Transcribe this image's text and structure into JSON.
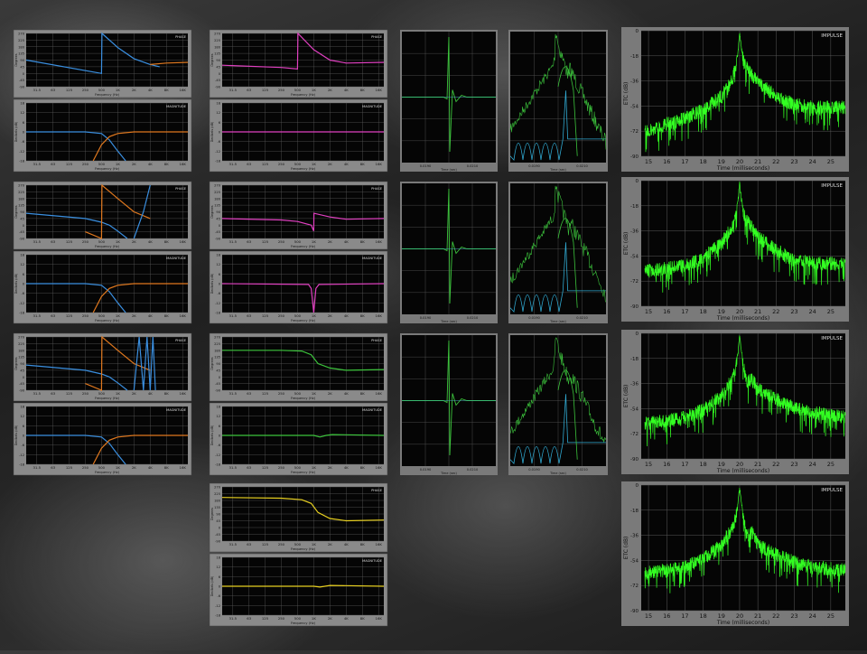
{
  "freq_ticks": [
    "31.5",
    "63",
    "125",
    "250",
    "500",
    "1K",
    "2K",
    "4K",
    "8K",
    "16K"
  ],
  "phase_ticks": [
    "270",
    "225",
    "180",
    "135",
    "90",
    "45",
    "0",
    "-45",
    "-90"
  ],
  "mag_ticks": [
    "18",
    "12",
    "6",
    "0",
    "-6",
    "-12",
    "-18"
  ],
  "labels": {
    "phase": "PHASE",
    "magnitude": "MAGNITUDE",
    "impulse": "IMPULSE",
    "freq_axis": "Frequency (Hz)",
    "phase_axis": "Degrees",
    "mag_axis": "Decibels (dB)",
    "time_axis": "Time (sec)",
    "etc_time_axis": "Time (milliseconds)",
    "etc_axis": "ETC (dB)"
  },
  "colors": {
    "blue": "#3a8fe0",
    "orange": "#e0781e",
    "magenta": "#e040c0",
    "green": "#3cc43c",
    "yellow": "#e8d020",
    "lime": "#33ff22",
    "cyan": "#30a8d0",
    "plot_bg": "#050505",
    "grid": "#5a5a5a"
  },
  "impulse_time_ticks": [
    "0.0190",
    "0.0210"
  ],
  "chart_data": [
    {
      "type": "line",
      "id": "phase-1",
      "title": "PHASE",
      "xlabel": "Frequency (Hz)",
      "ylabel": "Degrees",
      "ylim": [
        -90,
        270
      ],
      "xscale": "log",
      "series": [
        {
          "color": "blue",
          "x": [
            20,
            500,
            510,
            1000,
            2000,
            4000,
            6000
          ],
          "y": [
            90,
            0,
            270,
            175,
            100,
            60,
            45
          ]
        },
        {
          "color": "orange",
          "x": [
            4000,
            8000,
            20000
          ],
          "y": [
            60,
            70,
            75
          ]
        }
      ]
    },
    {
      "type": "line",
      "id": "mag-1",
      "title": "MAGNITUDE",
      "xlabel": "Frequency (Hz)",
      "ylabel": "Decibels (dB)",
      "ylim": [
        -18,
        18
      ],
      "xscale": "log",
      "series": [
        {
          "color": "blue",
          "x": [
            20,
            250,
            500,
            700,
            1000,
            1400
          ],
          "y": [
            0,
            0,
            -1,
            -5,
            -12,
            -18
          ]
        },
        {
          "color": "orange",
          "x": [
            350,
            500,
            700,
            1000,
            2000,
            20000
          ],
          "y": [
            -18,
            -8,
            -3,
            -1,
            0,
            0
          ]
        }
      ]
    },
    {
      "type": "line",
      "id": "phase-2",
      "title": "PHASE",
      "xlabel": "Frequency (Hz)",
      "ylabel": "Degrees",
      "ylim": [
        -90,
        270
      ],
      "xscale": "log",
      "series": [
        {
          "color": "magenta",
          "x": [
            20,
            250,
            500,
            510,
            1000,
            2000,
            4000,
            20000
          ],
          "y": [
            55,
            40,
            30,
            270,
            160,
            90,
            70,
            75
          ]
        }
      ]
    },
    {
      "type": "line",
      "id": "mag-2",
      "title": "MAGNITUDE",
      "xlabel": "Frequency (Hz)",
      "ylabel": "Decibels (dB)",
      "ylim": [
        -18,
        18
      ],
      "xscale": "log",
      "series": [
        {
          "color": "magenta",
          "x": [
            20,
            20000
          ],
          "y": [
            0,
            0
          ]
        }
      ]
    },
    {
      "type": "line",
      "id": "phase-3",
      "title": "PHASE",
      "xlabel": "Frequency (Hz)",
      "ylabel": "Degrees",
      "ylim": [
        -90,
        270
      ],
      "xscale": "log",
      "series": [
        {
          "color": "blue",
          "x": [
            20,
            250,
            500,
            700,
            1000,
            1500
          ],
          "y": [
            80,
            45,
            20,
            0,
            -40,
            -90
          ]
        },
        {
          "color": "orange",
          "x": [
            250,
            500,
            510,
            1000,
            2000,
            4000
          ],
          "y": [
            -45,
            -90,
            270,
            180,
            90,
            45
          ]
        },
        {
          "color": "blue",
          "x": [
            2000,
            3000,
            4000
          ],
          "y": [
            -90,
            90,
            270
          ]
        }
      ]
    },
    {
      "type": "line",
      "id": "mag-3",
      "title": "MAGNITUDE",
      "xlabel": "Frequency (Hz)",
      "ylabel": "Decibels (dB)",
      "ylim": [
        -18,
        18
      ],
      "xscale": "log",
      "series": [
        {
          "color": "blue",
          "x": [
            20,
            250,
            500,
            700,
            1000,
            1400
          ],
          "y": [
            0,
            0,
            -1,
            -5,
            -12,
            -18
          ]
        },
        {
          "color": "orange",
          "x": [
            350,
            500,
            700,
            1000,
            2000,
            20000
          ],
          "y": [
            -18,
            -8,
            -3,
            -1,
            0,
            0
          ]
        }
      ]
    },
    {
      "type": "line",
      "id": "phase-4",
      "title": "PHASE",
      "xlabel": "Frequency (Hz)",
      "ylabel": "Degrees",
      "ylim": [
        -90,
        270
      ],
      "xscale": "log",
      "series": [
        {
          "color": "magenta",
          "x": [
            20,
            250,
            500,
            900,
            1000,
            1010,
            2000,
            4000,
            20000
          ],
          "y": [
            45,
            35,
            25,
            0,
            -40,
            80,
            55,
            40,
            45
          ]
        }
      ]
    },
    {
      "type": "line",
      "id": "mag-4",
      "title": "MAGNITUDE",
      "xlabel": "Frequency (Hz)",
      "ylabel": "Decibels (dB)",
      "ylim": [
        -18,
        18
      ],
      "xscale": "log",
      "series": [
        {
          "color": "magenta",
          "x": [
            20,
            800,
            900,
            1000,
            1100,
            1250,
            20000
          ],
          "y": [
            0,
            -0.5,
            -3,
            -18,
            -3,
            -0.5,
            0
          ]
        }
      ]
    },
    {
      "type": "line",
      "id": "phase-5",
      "title": "PHASE",
      "xlabel": "Frequency (Hz)",
      "ylabel": "Degrees",
      "ylim": [
        -90,
        270
      ],
      "xscale": "log",
      "series": [
        {
          "color": "blue",
          "x": [
            20,
            250,
            500,
            700,
            1000,
            1500
          ],
          "y": [
            80,
            45,
            20,
            0,
            -40,
            -90
          ]
        },
        {
          "color": "orange",
          "x": [
            250,
            500,
            510,
            1000,
            2000,
            4000
          ],
          "y": [
            -45,
            -90,
            270,
            180,
            90,
            45
          ]
        },
        {
          "color": "blue",
          "x": [
            2000,
            2500,
            3000,
            3500,
            4000,
            4500,
            5000
          ],
          "y": [
            -90,
            270,
            -90,
            270,
            -90,
            270,
            -90
          ]
        }
      ]
    },
    {
      "type": "line",
      "id": "mag-5",
      "title": "MAGNITUDE",
      "xlabel": "Frequency (Hz)",
      "ylabel": "Decibels (dB)",
      "ylim": [
        -18,
        18
      ],
      "xscale": "log",
      "series": [
        {
          "color": "blue",
          "x": [
            20,
            250,
            500,
            700,
            1000,
            1400
          ],
          "y": [
            0,
            0,
            -1,
            -5,
            -12,
            -18
          ]
        },
        {
          "color": "orange",
          "x": [
            350,
            500,
            700,
            1000,
            2000,
            20000
          ],
          "y": [
            -18,
            -8,
            -3,
            -1,
            0,
            0
          ]
        }
      ]
    },
    {
      "type": "line",
      "id": "phase-6",
      "title": "PHASE",
      "xlabel": "Frequency (Hz)",
      "ylabel": "Degrees",
      "ylim": [
        -90,
        270
      ],
      "xscale": "log",
      "series": [
        {
          "color": "green",
          "x": [
            20,
            250,
            600,
            900,
            1200,
            2000,
            4000,
            20000
          ],
          "y": [
            180,
            180,
            175,
            150,
            90,
            60,
            45,
            50
          ]
        }
      ]
    },
    {
      "type": "line",
      "id": "mag-6",
      "title": "MAGNITUDE",
      "xlabel": "Frequency (Hz)",
      "ylabel": "Decibels (dB)",
      "ylim": [
        -18,
        18
      ],
      "xscale": "log",
      "series": [
        {
          "color": "green",
          "x": [
            20,
            1000,
            1300,
            1700,
            2200,
            20000
          ],
          "y": [
            0,
            0,
            -1,
            0,
            0.5,
            0
          ]
        }
      ]
    },
    {
      "type": "line",
      "id": "phase-7",
      "title": "PHASE",
      "xlabel": "Frequency (Hz)",
      "ylabel": "Degrees",
      "ylim": [
        -90,
        270
      ],
      "xscale": "log",
      "series": [
        {
          "color": "yellow",
          "x": [
            20,
            250,
            600,
            900,
            1200,
            2000,
            4000,
            20000
          ],
          "y": [
            200,
            195,
            185,
            160,
            100,
            60,
            45,
            50
          ]
        }
      ]
    },
    {
      "type": "line",
      "id": "mag-7",
      "title": "MAGNITUDE",
      "xlabel": "Frequency (Hz)",
      "ylabel": "Decibels (dB)",
      "ylim": [
        -18,
        18
      ],
      "xscale": "log",
      "series": [
        {
          "color": "yellow",
          "x": [
            20,
            1000,
            1300,
            2000,
            20000
          ],
          "y": [
            0,
            0,
            -0.5,
            0.5,
            0
          ]
        }
      ]
    },
    {
      "type": "line",
      "id": "etc-1",
      "title": "IMPULSE",
      "xlabel": "Time (milliseconds)",
      "ylabel": "ETC (dB)",
      "xlim": [
        14.6,
        25.8
      ],
      "ylim": [
        -90,
        0
      ],
      "x_ticks": [
        15,
        16,
        17,
        18,
        19,
        20,
        21,
        22,
        23,
        24,
        25
      ],
      "y_ticks": [
        0,
        -18,
        -36,
        -54,
        -72,
        -90
      ],
      "series": [
        {
          "color": "lime",
          "x": [
            14.8,
            16,
            17,
            18,
            19,
            19.6,
            19.9,
            20,
            20.1,
            20.3,
            21,
            22,
            23,
            24,
            25.8
          ],
          "y": [
            -68,
            -62,
            -58,
            -52,
            -42,
            -30,
            -15,
            0,
            -12,
            -20,
            -32,
            -42,
            -48,
            -50,
            -50
          ]
        }
      ]
    },
    {
      "type": "line",
      "id": "etc-2",
      "title": "IMPULSE",
      "xlabel": "Time (milliseconds)",
      "ylabel": "ETC (dB)",
      "xlim": [
        14.6,
        25.8
      ],
      "ylim": [
        -90,
        0
      ],
      "x_ticks": [
        15,
        16,
        17,
        18,
        19,
        20,
        21,
        22,
        23,
        24,
        25
      ],
      "y_ticks": [
        0,
        -18,
        -36,
        -54,
        -72,
        -90
      ],
      "series": [
        {
          "color": "lime",
          "x": [
            14.8,
            16,
            17,
            18,
            19,
            19.6,
            19.9,
            20,
            20.1,
            20.3,
            21,
            22,
            23,
            24,
            25.8
          ],
          "y": [
            -60,
            -58,
            -56,
            -50,
            -40,
            -28,
            -14,
            0,
            -12,
            -22,
            -35,
            -45,
            -52,
            -54,
            -55
          ]
        }
      ]
    },
    {
      "type": "line",
      "id": "etc-3",
      "title": "IMPULSE",
      "xlabel": "Time (milliseconds)",
      "ylabel": "ETC (dB)",
      "xlim": [
        14.6,
        25.8
      ],
      "ylim": [
        -90,
        0
      ],
      "x_ticks": [
        15,
        16,
        17,
        18,
        19,
        20,
        21,
        22,
        23,
        24,
        25
      ],
      "y_ticks": [
        0,
        -18,
        -36,
        -54,
        -72,
        -90
      ],
      "series": [
        {
          "color": "lime",
          "x": [
            14.8,
            16,
            17,
            18,
            19,
            19.6,
            19.9,
            20,
            20.1,
            20.4,
            20.7,
            21,
            22,
            23,
            24,
            25.8
          ],
          "y": [
            -60,
            -58,
            -55,
            -50,
            -40,
            -28,
            -14,
            0,
            -12,
            -30,
            -28,
            -35,
            -42,
            -48,
            -52,
            -55
          ]
        }
      ]
    },
    {
      "type": "line",
      "id": "etc-4",
      "title": "IMPULSE",
      "xlabel": "Time (milliseconds)",
      "ylabel": "ETC (dB)",
      "xlim": [
        14.6,
        25.8
      ],
      "ylim": [
        -90,
        0
      ],
      "x_ticks": [
        15,
        16,
        17,
        18,
        19,
        20,
        21,
        22,
        23,
        24,
        25
      ],
      "y_ticks": [
        0,
        -18,
        -36,
        -54,
        -72,
        -90
      ],
      "series": [
        {
          "color": "lime",
          "x": [
            14.8,
            16,
            17,
            18,
            19,
            19.6,
            19.9,
            20,
            20.1,
            20.4,
            20.7,
            21,
            22,
            23,
            24,
            25.8
          ],
          "y": [
            -58,
            -56,
            -54,
            -48,
            -38,
            -26,
            -13,
            0,
            -12,
            -32,
            -28,
            -38,
            -45,
            -50,
            -54,
            -56
          ]
        }
      ]
    }
  ]
}
